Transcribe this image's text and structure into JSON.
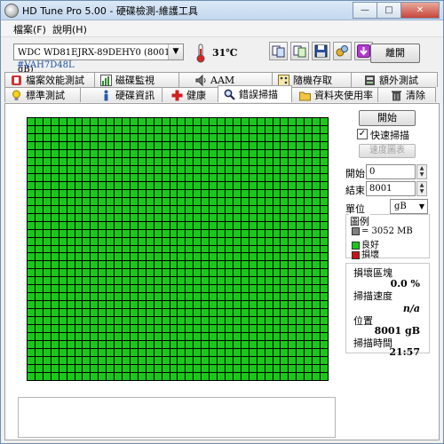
{
  "window": {
    "title": "HD Tune Pro  5.00 - 硬碟檢測-維護工具",
    "minimize": "—",
    "maximize": "□",
    "close": "✕"
  },
  "menu": {
    "file": "檔案(F)",
    "help": "說明(H)"
  },
  "toolbar": {
    "drive": "WDC WD81EJRX-89DEHY0 (8001 gB)",
    "drive_serial": "#VAH7D48L",
    "temperature": "31℃",
    "exit": "離開"
  },
  "tabs_top": [
    {
      "label": "檔案效能測試",
      "icon": "file-bench-icon"
    },
    {
      "label": "磁碟監視",
      "icon": "chart-icon"
    },
    {
      "label": "AAM",
      "icon": "speaker-icon"
    },
    {
      "label": "隨機存取",
      "icon": "random-access-icon"
    },
    {
      "label": "額外測試",
      "icon": "extra-test-icon"
    }
  ],
  "tabs_bottom": [
    {
      "label": "標準測試",
      "icon": "lightbulb-icon"
    },
    {
      "label": "硬碟資訊",
      "icon": "info-icon"
    },
    {
      "label": "健康",
      "icon": "health-cross-icon"
    },
    {
      "label": "錯誤掃描",
      "icon": "magnifier-icon",
      "active": true
    },
    {
      "label": "資料夾使用率",
      "icon": "folder-icon"
    },
    {
      "label": "清除",
      "icon": "trash-icon"
    }
  ],
  "scan": {
    "start_button": "開始",
    "quick_scan_label": "快速掃描",
    "quick_scan_checked": true,
    "speed_chart_button": "速度圖表",
    "start_label": "開始",
    "start_value": "0",
    "end_label": "結束",
    "end_value": "8001",
    "unit_label": "單位",
    "unit_value": "gB",
    "legend_title": "圖例",
    "legend_block": "= 3052 MB",
    "legend_good": "良好",
    "legend_bad": "損壞",
    "damaged_blocks_label": "損壞區塊",
    "damaged_blocks_value": "0.0 %",
    "scan_speed_label": "掃描速度",
    "scan_speed_value": "n/a",
    "position_label": "位置",
    "position_value": "8001 gB",
    "scan_time_label": "掃描時間",
    "scan_time_value": "21:57"
  },
  "colors": {
    "good_block": "#19c819",
    "bad_block": "#c81414",
    "legend_block": "#808080",
    "grid_line": "#000000"
  },
  "block_grid": {
    "columns": 38,
    "rows": 33,
    "status": "all-good"
  }
}
